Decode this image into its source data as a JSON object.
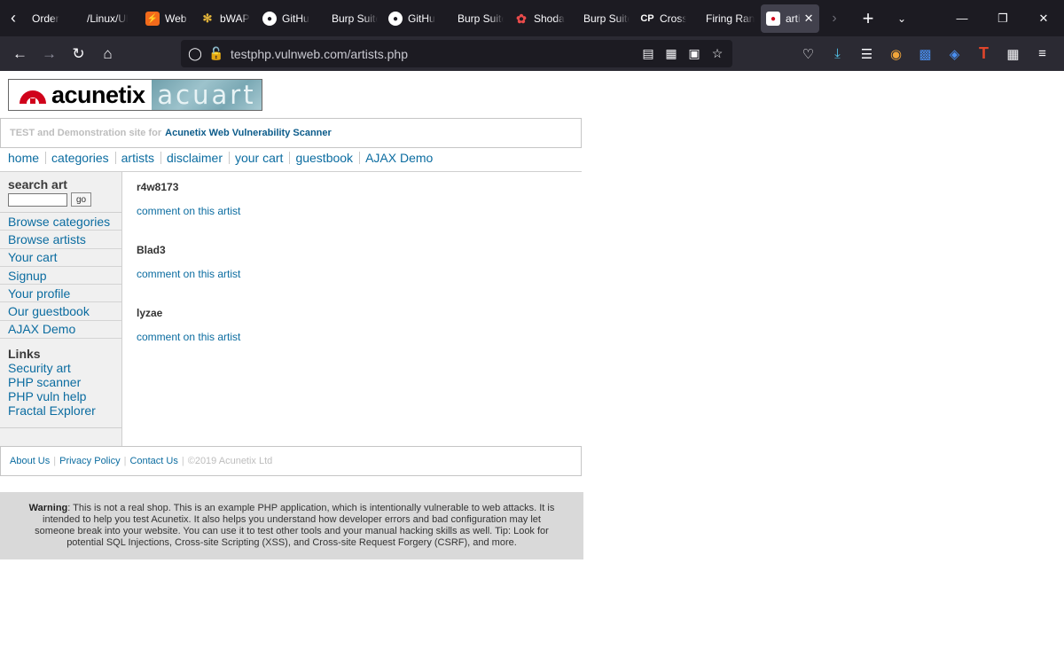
{
  "browser": {
    "tabs": [
      {
        "title": "Order",
        "favicon": "none"
      },
      {
        "title": "/Linux/Ub",
        "favicon": "none"
      },
      {
        "title": "Web A",
        "favicon": "bolt-icon"
      },
      {
        "title": "bWAP",
        "favicon": "bee-icon"
      },
      {
        "title": "GitHu",
        "favicon": "github-icon"
      },
      {
        "title": "Burp Suite",
        "favicon": "none"
      },
      {
        "title": "GitHu",
        "favicon": "github-icon"
      },
      {
        "title": "Burp Suite",
        "favicon": "none"
      },
      {
        "title": "Shoda",
        "favicon": "shodan-icon"
      },
      {
        "title": "Burp Suite",
        "favicon": "none"
      },
      {
        "title": "Cross-",
        "favicon": "cp-icon"
      },
      {
        "title": "Firing Ran",
        "favicon": "none"
      },
      {
        "title": "arti",
        "favicon": "acunetix-icon",
        "active": true
      }
    ],
    "cp_label": "CP",
    "url": "testphp.vulnweb.com/artists.php"
  },
  "site": {
    "logo_word": "acunetix",
    "logo_sub": "acuart",
    "tagline_prefix": "TEST and Demonstration site for",
    "tagline_link": "Acunetix Web Vulnerability Scanner",
    "nav": [
      "home",
      "categories",
      "artists",
      "disclaimer",
      "your cart",
      "guestbook",
      "AJAX Demo"
    ],
    "sidebar": {
      "search_heading": "search art",
      "go_label": "go",
      "menu": [
        "Browse categories",
        "Browse artists",
        "Your cart",
        "Signup",
        "Your profile",
        "Our guestbook",
        "AJAX Demo"
      ],
      "links_heading": "Links",
      "links": [
        "Security art",
        "PHP scanner",
        "PHP vuln help",
        "Fractal Explorer"
      ]
    },
    "artists": [
      {
        "name": "r4w8173",
        "link": "comment on this artist"
      },
      {
        "name": "Blad3",
        "link": "comment on this artist"
      },
      {
        "name": "lyzae",
        "link": "comment on this artist"
      }
    ],
    "footer": {
      "links": [
        "About Us",
        "Privacy Policy",
        "Contact Us"
      ],
      "copyright": "©2019 Acunetix Ltd"
    },
    "warning": {
      "label": "Warning",
      "text": ": This is not a real shop. This is an example PHP application, which is intentionally vulnerable to web attacks. It is intended to help you test Acunetix. It also helps you understand how developer errors and bad configuration may let someone break into your website. You can use it to test other tools and your manual hacking skills as well. Tip: Look for potential SQL Injections, Cross-site Scripting (XSS), and Cross-site Request Forgery (CSRF), and more."
    }
  },
  "colors": {
    "link": "#0b6ca0",
    "tabbar_bg": "#1c1b22",
    "navbar_bg": "#2b2a33",
    "accent_red": "#d0021b"
  }
}
